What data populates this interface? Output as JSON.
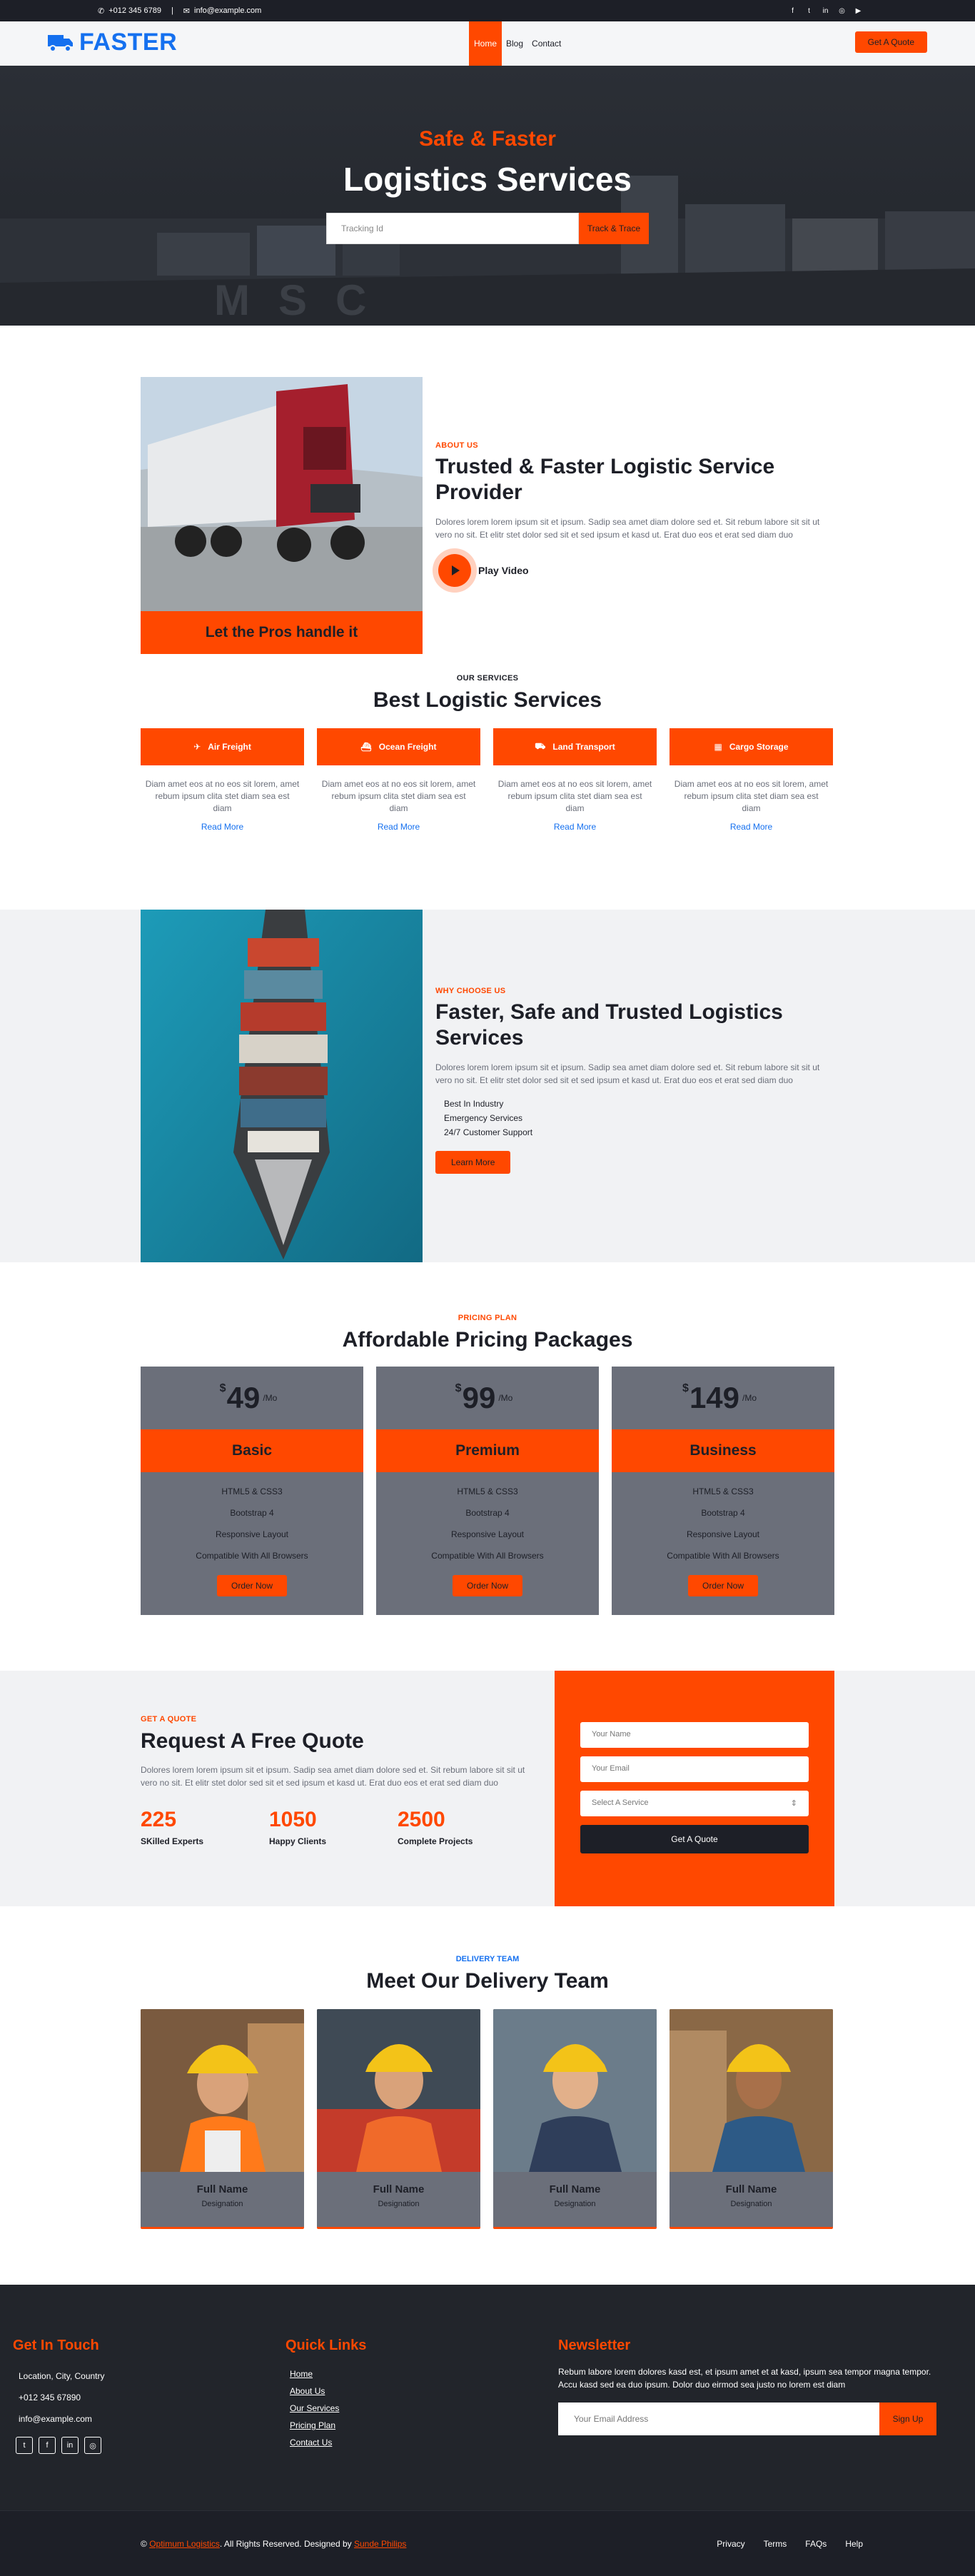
{
  "topbar": {
    "phone": "+012 345 6789",
    "email": "info@example.com",
    "social": [
      "facebook-icon",
      "twitter-icon",
      "linkedin-icon",
      "instagram-icon",
      "youtube-icon"
    ]
  },
  "nav": {
    "logo": "FASTER",
    "items": [
      "Home",
      "Blog",
      "Contact"
    ],
    "active": "Home",
    "quote_btn": "Get A Quote"
  },
  "hero": {
    "subtitle": "Safe & Faster",
    "title": "Logistics Services",
    "tracking_placeholder": "Tracking Id",
    "track_btn": "Track & Trace"
  },
  "about": {
    "caption": "Let the Pros handle it",
    "label": "ABOUT US",
    "title": "Trusted & Faster Logistic Service Provider",
    "text": "Dolores lorem lorem ipsum sit et ipsum. Sadip sea amet diam dolore sed et. Sit rebum labore sit sit ut vero no sit. Et elitr stet dolor sed sit et sed ipsum et kasd ut. Erat duo eos et erat sed diam duo",
    "play": "Play Video"
  },
  "services": {
    "label": "OUR SERVICES",
    "title": "Best Logistic Services",
    "items": [
      {
        "name": "Air Freight",
        "text": "Diam amet eos at no eos sit lorem, amet rebum ipsum clita stet diam sea est diam",
        "link": "Read More"
      },
      {
        "name": "Ocean Freight",
        "text": "Diam amet eos at no eos sit lorem, amet rebum ipsum clita stet diam sea est diam",
        "link": "Read More"
      },
      {
        "name": "Land Transport",
        "text": "Diam amet eos at no eos sit lorem, amet rebum ipsum clita stet diam sea est diam",
        "link": "Read More"
      },
      {
        "name": "Cargo Storage",
        "text": "Diam amet eos at no eos sit lorem, amet rebum ipsum clita stet diam sea est diam",
        "link": "Read More"
      }
    ]
  },
  "why": {
    "label": "WHY CHOOSE US",
    "title": "Faster, Safe and Trusted Logistics Services",
    "text": "Dolores lorem lorem ipsum sit et ipsum. Sadip sea amet diam dolore sed et. Sit rebum labore sit sit ut vero no sit. Et elitr stet dolor sed sit et sed ipsum et kasd ut. Erat duo eos et erat sed diam duo",
    "bullets": [
      "Best In Industry",
      "Emergency Services",
      "24/7 Customer Support"
    ],
    "btn": "Learn More"
  },
  "pricing": {
    "label": "PRICING PLAN",
    "title": "Affordable Pricing Packages",
    "currency": "$",
    "period": "/Mo",
    "plans": [
      {
        "price": "49",
        "name": "Basic"
      },
      {
        "price": "99",
        "name": "Premium"
      },
      {
        "price": "149",
        "name": "Business"
      }
    ],
    "features": [
      "HTML5 & CSS3",
      "Bootstrap 4",
      "Responsive Layout",
      "Compatible With All Browsers"
    ],
    "btn": "Order Now"
  },
  "quote": {
    "label": "GET A QUOTE",
    "title": "Request A Free Quote",
    "text": "Dolores lorem lorem ipsum sit et ipsum. Sadip sea amet diam dolore sed et. Sit rebum labore sit sit ut vero no sit. Et elitr stet dolor sed sit et sed ipsum et kasd ut. Erat duo eos et erat sed diam duo",
    "stats": [
      {
        "n": "225",
        "l": "SKilled Experts"
      },
      {
        "n": "1050",
        "l": "Happy Clients"
      },
      {
        "n": "2500",
        "l": "Complete Projects"
      }
    ],
    "name_ph": "Your Name",
    "email_ph": "Your Email",
    "service_sel": "Select A Service",
    "btn": "Get A Quote"
  },
  "team": {
    "label": "DELIVERY TEAM",
    "title": "Meet Our Delivery Team",
    "members": [
      {
        "name": "Full Name",
        "role": "Designation"
      },
      {
        "name": "Full Name",
        "role": "Designation"
      },
      {
        "name": "Full Name",
        "role": "Designation"
      },
      {
        "name": "Full Name",
        "role": "Designation"
      }
    ]
  },
  "footer": {
    "touch": {
      "title": "Get In Touch",
      "address": "Location, City, Country",
      "phone": "+012 345 67890",
      "email": "info@example.com"
    },
    "links": {
      "title": "Quick Links",
      "items": [
        "Home",
        "About Us",
        "Our Services",
        "Pricing Plan",
        "Contact Us"
      ]
    },
    "news": {
      "title": "Newsletter",
      "text": "Rebum labore lorem dolores kasd est, et ipsum amet et at kasd, ipsum sea tempor magna tempor. Accu kasd sed ea duo ipsum. Dolor duo eirmod sea justo no lorem est diam",
      "placeholder": "Your Email Address",
      "btn": "Sign Up"
    },
    "copy": {
      "symbol": "©",
      "brand": "Optimum Logistics",
      "rights": ". All Rights Reserved. Designed by",
      "designer": "Sunde Philips"
    },
    "bottom_links": [
      "Privacy",
      "Terms",
      "FAQs",
      "Help"
    ]
  },
  "colors": {
    "accent": "#ff4800",
    "dark": "#1d1f27",
    "brand": "#1570ef",
    "gray": "#6b6f7a"
  }
}
